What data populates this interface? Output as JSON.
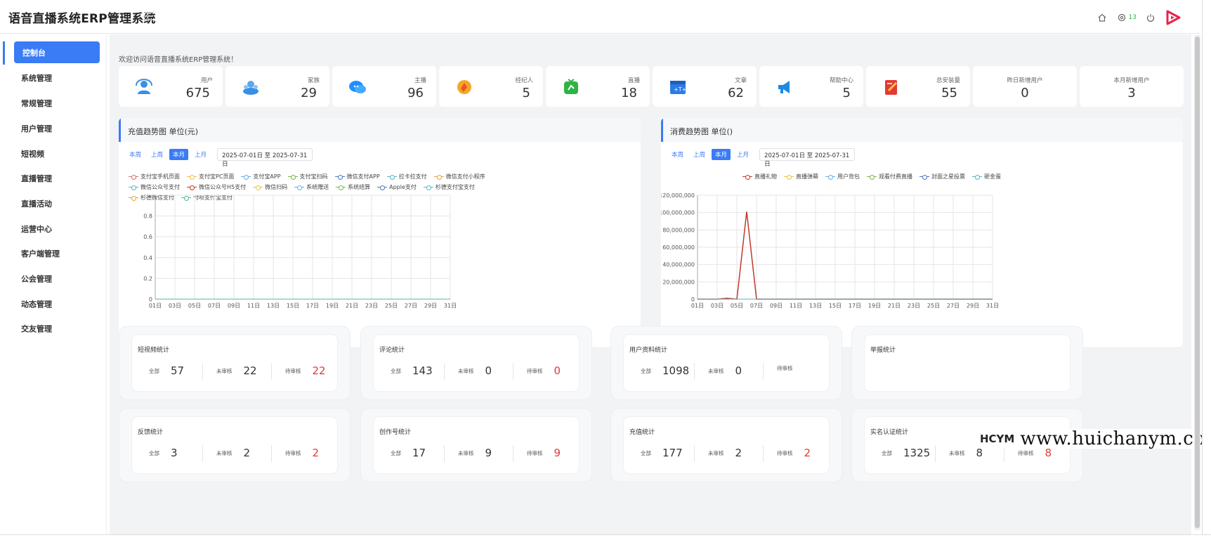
{
  "app": {
    "title": "语音直播系统ERP管理系统",
    "badge_count": "13"
  },
  "header_icons": [
    "home-icon",
    "settings-icon",
    "power-icon",
    "brand-logo-icon"
  ],
  "sidebar": {
    "items": [
      {
        "label": "控制台",
        "active": true
      },
      {
        "label": "系统管理"
      },
      {
        "label": "常规管理"
      },
      {
        "label": "用户管理"
      },
      {
        "label": "短视频"
      },
      {
        "label": "直播管理"
      },
      {
        "label": "直播活动"
      },
      {
        "label": "运营中心"
      },
      {
        "label": "客户端管理"
      },
      {
        "label": "公会管理"
      },
      {
        "label": "动态管理"
      },
      {
        "label": "交友管理"
      }
    ]
  },
  "welcome": "欢迎访问语音直播系统ERP管理系统！",
  "stats": [
    {
      "label": "用户",
      "value": "675",
      "icon": "user-icon",
      "color": "#3a8ee6"
    },
    {
      "label": "家族",
      "value": "29",
      "icon": "family-icon",
      "color": "#3a8ee6"
    },
    {
      "label": "主播",
      "value": "96",
      "icon": "anchor-icon",
      "color": "#1e90ff"
    },
    {
      "label": "经纪人",
      "value": "5",
      "icon": "agent-icon",
      "color": "#f5a623"
    },
    {
      "label": "直播",
      "value": "18",
      "icon": "live-icon",
      "color": "#2fb344"
    },
    {
      "label": "文章",
      "value": "62",
      "icon": "article-icon",
      "color": "#2a7be4"
    },
    {
      "label": "帮助中心",
      "value": "5",
      "icon": "megaphone-icon",
      "color": "#1e88e5"
    },
    {
      "label": "总安装量",
      "value": "55",
      "icon": "install-icon",
      "color": "#e53935"
    },
    {
      "label": "昨日新增用户",
      "value": "0"
    },
    {
      "label": "本月新增用户",
      "value": "3"
    }
  ],
  "recharge_panel": {
    "title": "充值趋势图 单位(元)",
    "tabs": [
      "本周",
      "上周",
      "本月",
      "上月"
    ],
    "active_tab": "本月",
    "date_range": "2025-07-01日 至 2025-07-31日"
  },
  "consume_panel": {
    "title": "消费趋势图 单位()",
    "tabs": [
      "本周",
      "上周",
      "本月",
      "上月"
    ],
    "active_tab": "本月",
    "date_range": "2025-07-01日 至 2025-07-31日"
  },
  "chart_data": [
    {
      "type": "line",
      "title": "充值趋势图 单位(元)",
      "x": [
        "01日",
        "03日",
        "05日",
        "07日",
        "09日",
        "11日",
        "13日",
        "15日",
        "17日",
        "19日",
        "21日",
        "23日",
        "25日",
        "27日",
        "29日",
        "31日"
      ],
      "y_ticks": [
        "0",
        "0.2",
        "0.4",
        "0.6",
        "0.8"
      ],
      "ylim": [
        0,
        1
      ],
      "series": [
        {
          "name": "支付宝手机页面",
          "color": "#e06c75",
          "values": [
            0,
            0,
            0,
            0,
            0,
            0,
            0,
            0,
            0,
            0,
            0,
            0,
            0,
            0,
            0,
            0
          ]
        },
        {
          "name": "支付宝PC页面",
          "color": "#f0c040",
          "values": [
            0,
            0,
            0,
            0,
            0,
            0,
            0,
            0,
            0,
            0,
            0,
            0,
            0,
            0,
            0,
            0
          ]
        },
        {
          "name": "支付宝APP",
          "color": "#61afef",
          "values": [
            0,
            0,
            0,
            0,
            0,
            0,
            0,
            0,
            0,
            0,
            0,
            0,
            0,
            0,
            0,
            0
          ]
        },
        {
          "name": "支付宝扫码",
          "color": "#7cb342",
          "values": [
            0,
            0,
            0,
            0,
            0,
            0,
            0,
            0,
            0,
            0,
            0,
            0,
            0,
            0,
            0,
            0
          ]
        },
        {
          "name": "微信支付APP",
          "color": "#4a78c2",
          "values": [
            0,
            0,
            0,
            0,
            0,
            0,
            0,
            0,
            0,
            0,
            0,
            0,
            0,
            0,
            0,
            0
          ]
        },
        {
          "name": "拉卡拉支付",
          "color": "#56b6c2",
          "values": [
            0,
            0,
            0,
            0,
            0,
            0,
            0,
            0,
            0,
            0,
            0,
            0,
            0,
            0,
            0,
            0
          ]
        },
        {
          "name": "微信支付小程序",
          "color": "#e5a03c",
          "values": [
            0,
            0,
            0,
            0,
            0,
            0,
            0,
            0,
            0,
            0,
            0,
            0,
            0,
            0,
            0,
            0
          ]
        },
        {
          "name": "微信公众号支付",
          "color": "#56b6c2",
          "values": [
            0,
            0,
            0,
            0,
            0,
            0,
            0,
            0,
            0,
            0,
            0,
            0,
            0,
            0,
            0,
            0
          ]
        },
        {
          "name": "微信公众号H5支付",
          "color": "#c0392b",
          "values": [
            0,
            0,
            0,
            0,
            0,
            0,
            0,
            0,
            0,
            0,
            0,
            0,
            0,
            0,
            0,
            0
          ]
        },
        {
          "name": "微信扫码",
          "color": "#f0c040",
          "values": [
            0,
            0,
            0,
            0,
            0,
            0,
            0,
            0,
            0,
            0,
            0,
            0,
            0,
            0,
            0,
            0
          ]
        },
        {
          "name": "系统赠送",
          "color": "#61afef",
          "values": [
            0,
            0,
            0,
            0,
            0,
            0,
            0,
            0,
            0,
            0,
            0,
            0,
            0,
            0,
            0,
            0
          ]
        },
        {
          "name": "系统结算",
          "color": "#7cb342",
          "values": [
            0,
            0,
            0,
            0,
            0,
            0,
            0,
            0,
            0,
            0,
            0,
            0,
            0,
            0,
            0,
            0
          ]
        },
        {
          "name": "Apple支付",
          "color": "#4a78c2",
          "values": [
            0,
            0,
            0,
            0,
            0,
            0,
            0,
            0,
            0,
            0,
            0,
            0,
            0,
            0,
            0,
            0
          ]
        },
        {
          "name": "杉德支付宝支付",
          "color": "#56b6c2",
          "values": [
            0,
            0,
            0,
            0,
            0,
            0,
            0,
            0,
            0,
            0,
            0,
            0,
            0,
            0,
            0,
            0
          ]
        },
        {
          "name": "杉德微信支付",
          "color": "#e5a03c",
          "values": [
            0,
            0,
            0,
            0,
            0,
            0,
            0,
            0,
            0,
            0,
            0,
            0,
            0,
            0,
            0,
            0
          ]
        },
        {
          "name": "付呗支付宝支付",
          "color": "#4cb89a",
          "values": [
            0,
            0,
            0,
            0,
            0,
            0,
            0,
            0,
            0,
            0,
            0,
            0,
            0,
            0,
            0,
            0
          ]
        }
      ]
    },
    {
      "type": "line",
      "title": "消费趋势图 单位()",
      "x": [
        "01日",
        "03日",
        "05日",
        "07日",
        "09日",
        "11日",
        "13日",
        "15日",
        "17日",
        "19日",
        "21日",
        "23日",
        "25日",
        "27日",
        "29日",
        "31日"
      ],
      "y_ticks": [
        "0",
        "20,000,000",
        "40,000,000",
        "60,000,000",
        "80,000,000",
        "100,000,000",
        "120,000,000"
      ],
      "ylim": [
        0,
        120000000
      ],
      "series": [
        {
          "name": "直播礼物",
          "color": "#c0392b",
          "values": [
            0,
            0,
            0,
            1000000,
            0,
            101000000,
            0,
            0,
            0,
            0,
            0,
            0,
            0,
            0,
            0,
            0,
            0,
            0,
            0,
            0,
            0,
            0,
            0,
            0,
            0,
            0,
            0,
            0,
            0,
            0,
            0
          ],
          "daily": true
        },
        {
          "name": "直播弹幕",
          "color": "#f0c040",
          "values": []
        },
        {
          "name": "用户背包",
          "color": "#61afef",
          "values": []
        },
        {
          "name": "观看付费直播",
          "color": "#7cb342",
          "values": []
        },
        {
          "name": "封面之星投票",
          "color": "#4a78c2",
          "values": []
        },
        {
          "name": "砸金蛋",
          "color": "#56b6c2",
          "values": []
        }
      ]
    }
  ],
  "review_cards": [
    {
      "title": "短视频统计",
      "all_label": "全部",
      "all": "57",
      "unreviewed_label": "未审核",
      "unreviewed": "22",
      "pending_label": "待审核",
      "pending": "22"
    },
    {
      "title": "评论统计",
      "all_label": "全部",
      "all": "143",
      "unreviewed_label": "未审核",
      "unreviewed": "0",
      "pending_label": "待审核",
      "pending": "0"
    },
    {
      "title": "用户资料统计",
      "all_label": "全部",
      "all": "1098",
      "unreviewed_label": "未审核",
      "unreviewed": "0",
      "pending_label": "待审核",
      "pending": ""
    },
    {
      "title": "举报统计",
      "all_label": "",
      "all": "",
      "unreviewed_label": "",
      "unreviewed": "",
      "pending_label": "",
      "pending": ""
    },
    {
      "title": "反馈统计",
      "all_label": "全部",
      "all": "3",
      "unreviewed_label": "未审核",
      "unreviewed": "2",
      "pending_label": "待审核",
      "pending": "2"
    },
    {
      "title": "创作号统计",
      "all_label": "全部",
      "all": "17",
      "unreviewed_label": "未审核",
      "unreviewed": "9",
      "pending_label": "待审核",
      "pending": "9"
    },
    {
      "title": "充值统计",
      "all_label": "全部",
      "all": "177",
      "unreviewed_label": "未审核",
      "unreviewed": "2",
      "pending_label": "待审核",
      "pending": "2"
    },
    {
      "title": "实名认证统计",
      "all_label": "全部",
      "all": "1325",
      "unreviewed_label": "未审核",
      "unreviewed": "8",
      "pending_label": "待审核",
      "pending": "8"
    }
  ],
  "watermark": {
    "logo": "HCYM",
    "url": "www.huichanym.com"
  }
}
